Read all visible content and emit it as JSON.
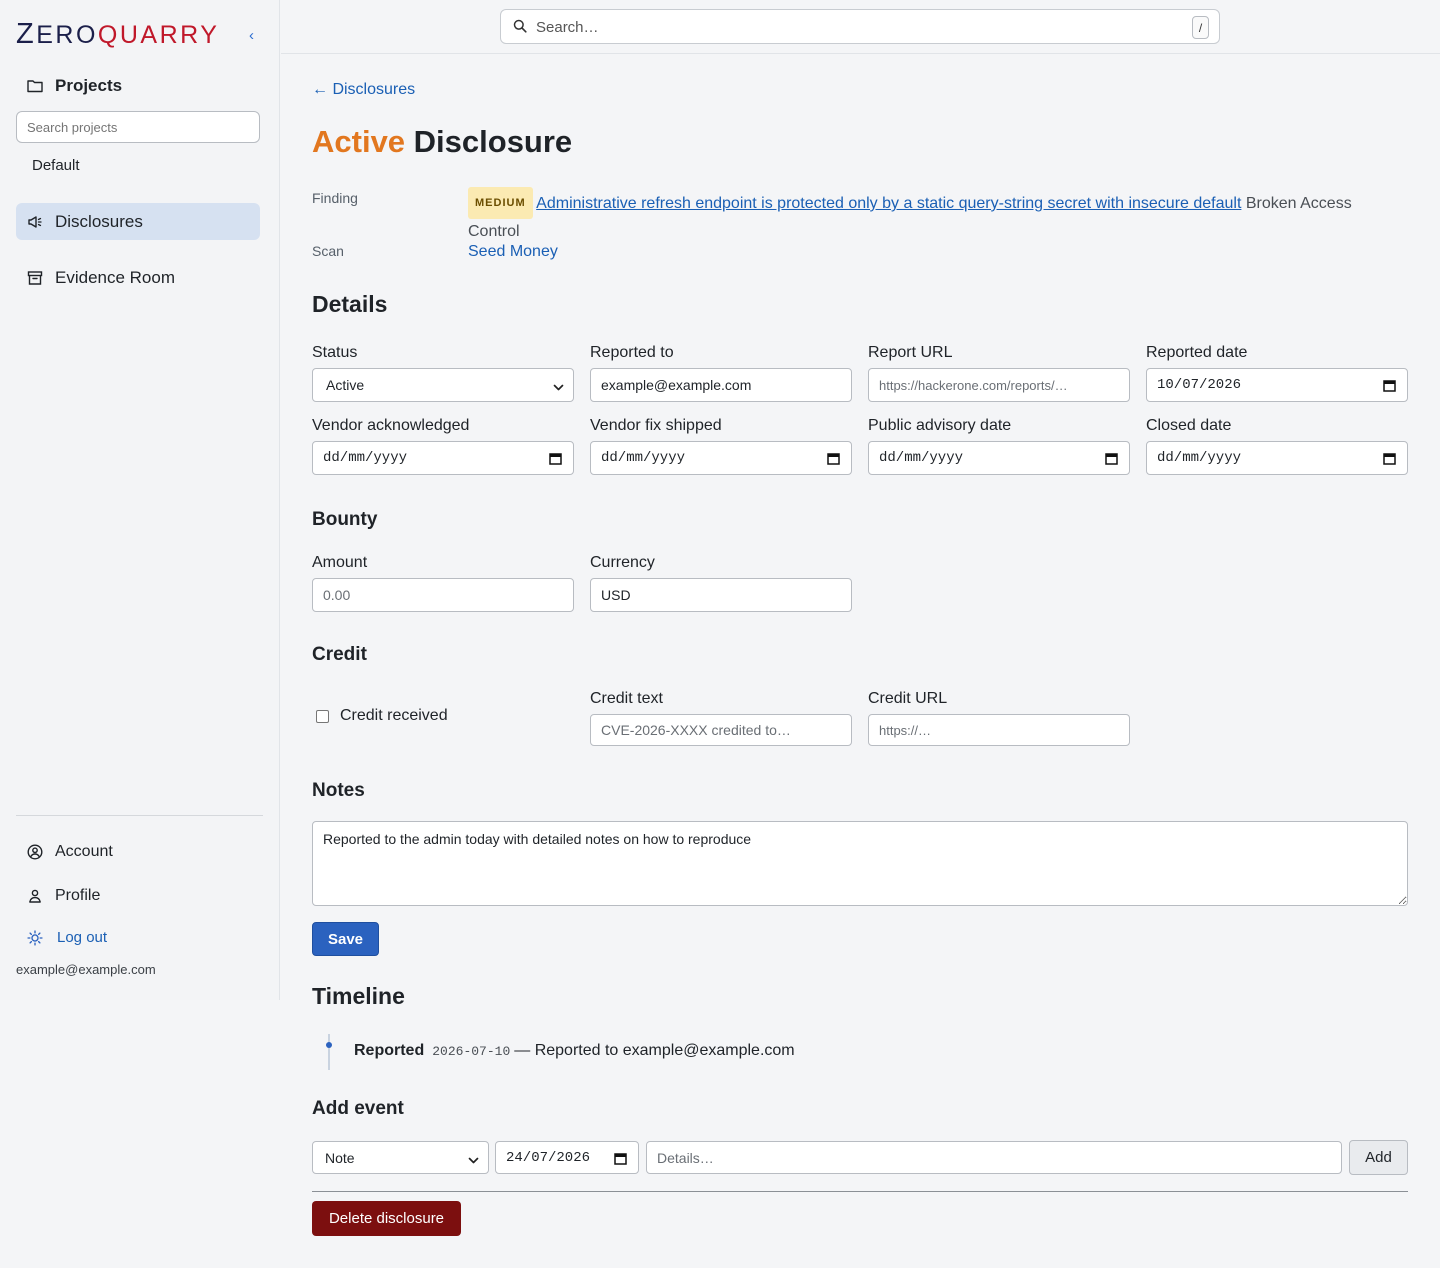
{
  "brand": {
    "logo_z": "Z",
    "logo_ero": "ERO",
    "logo_quarry": "QUARRY",
    "collapse_glyph": "‹"
  },
  "sidebar": {
    "projects_label": "Projects",
    "search_placeholder": "Search projects",
    "projects": [
      "Default"
    ],
    "nav": [
      {
        "label": "Disclosures",
        "icon": "megaphone-icon",
        "active": true
      },
      {
        "label": "Evidence Room",
        "icon": "archive-box-icon",
        "active": false
      }
    ],
    "account_label": "Account",
    "profile_label": "Profile",
    "logout_label": "Log out",
    "user_email": "example@example.com"
  },
  "topbar": {
    "search_placeholder": "Search…",
    "shortcut_key": "/"
  },
  "page": {
    "back_label": "← Disclosures",
    "title_status": "Active",
    "title_rest": " Disclosure",
    "status_color": "#e2771f",
    "finding_label": "Finding",
    "severity": "MEDIUM",
    "finding_title": "Administrative refresh endpoint is protected only by a static query-string secret with insecure default",
    "finding_category": "Broken Access Control",
    "scan_label": "Scan",
    "scan_name": "Seed Money"
  },
  "details": {
    "heading": "Details",
    "status_label": "Status",
    "status_value": "Active",
    "reported_to_label": "Reported to",
    "reported_to_value": "example@example.com",
    "report_url_label": "Report URL",
    "report_url_placeholder": "https://hackerone.com/reports/…",
    "reported_date_label": "Reported date",
    "reported_date_value": "10/07/2026",
    "vendor_ack_label": "Vendor acknowledged",
    "vendor_ack_placeholder": "dd/mm/yyyy",
    "vendor_fix_label": "Vendor fix shipped",
    "vendor_fix_placeholder": "dd/mm/yyyy",
    "public_advisory_label": "Public advisory date",
    "public_advisory_placeholder": "dd/mm/yyyy",
    "closed_date_label": "Closed date",
    "closed_date_placeholder": "dd/mm/yyyy"
  },
  "bounty": {
    "heading": "Bounty",
    "amount_label": "Amount",
    "amount_placeholder": "0.00",
    "currency_label": "Currency",
    "currency_value": "USD"
  },
  "credit": {
    "heading": "Credit",
    "received_label": "Credit received",
    "received_checked": false,
    "text_label": "Credit text",
    "text_placeholder": "CVE-2026-XXXX credited to…",
    "url_label": "Credit URL",
    "url_placeholder": "https://…"
  },
  "notes": {
    "heading": "Notes",
    "value": "Reported to the admin today with detailed notes on how to reproduce"
  },
  "save_label": "Save",
  "timeline": {
    "heading": "Timeline",
    "events": [
      {
        "kind": "Reported",
        "date": "2026-07-10",
        "detail": "— Reported to example@example.com"
      }
    ]
  },
  "add_event": {
    "heading": "Add event",
    "type_value": "Note",
    "date_value": "24/07/2026",
    "details_placeholder": "Details…",
    "add_label": "Add"
  },
  "delete_label": "Delete disclosure"
}
